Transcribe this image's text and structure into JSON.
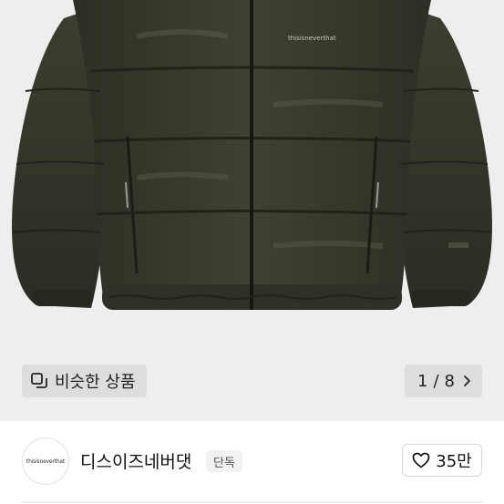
{
  "gallery": {
    "image_logo_text": "thisisneverthat",
    "similar_button_label": "비슷한 상품",
    "page_current": "1",
    "page_separator": "/",
    "page_total": "8"
  },
  "seller": {
    "avatar_text": "thisisneverthat",
    "name": "디스이즈네버댓",
    "badge": "단독",
    "like_count": "35만"
  },
  "colors": {
    "jacket": "#3a3d2f",
    "gallery_bg": "#eeeeee"
  },
  "icons": {
    "similar": "stacked-squares-icon",
    "next": "chevron-right-icon",
    "like": "heart-outline-icon"
  }
}
